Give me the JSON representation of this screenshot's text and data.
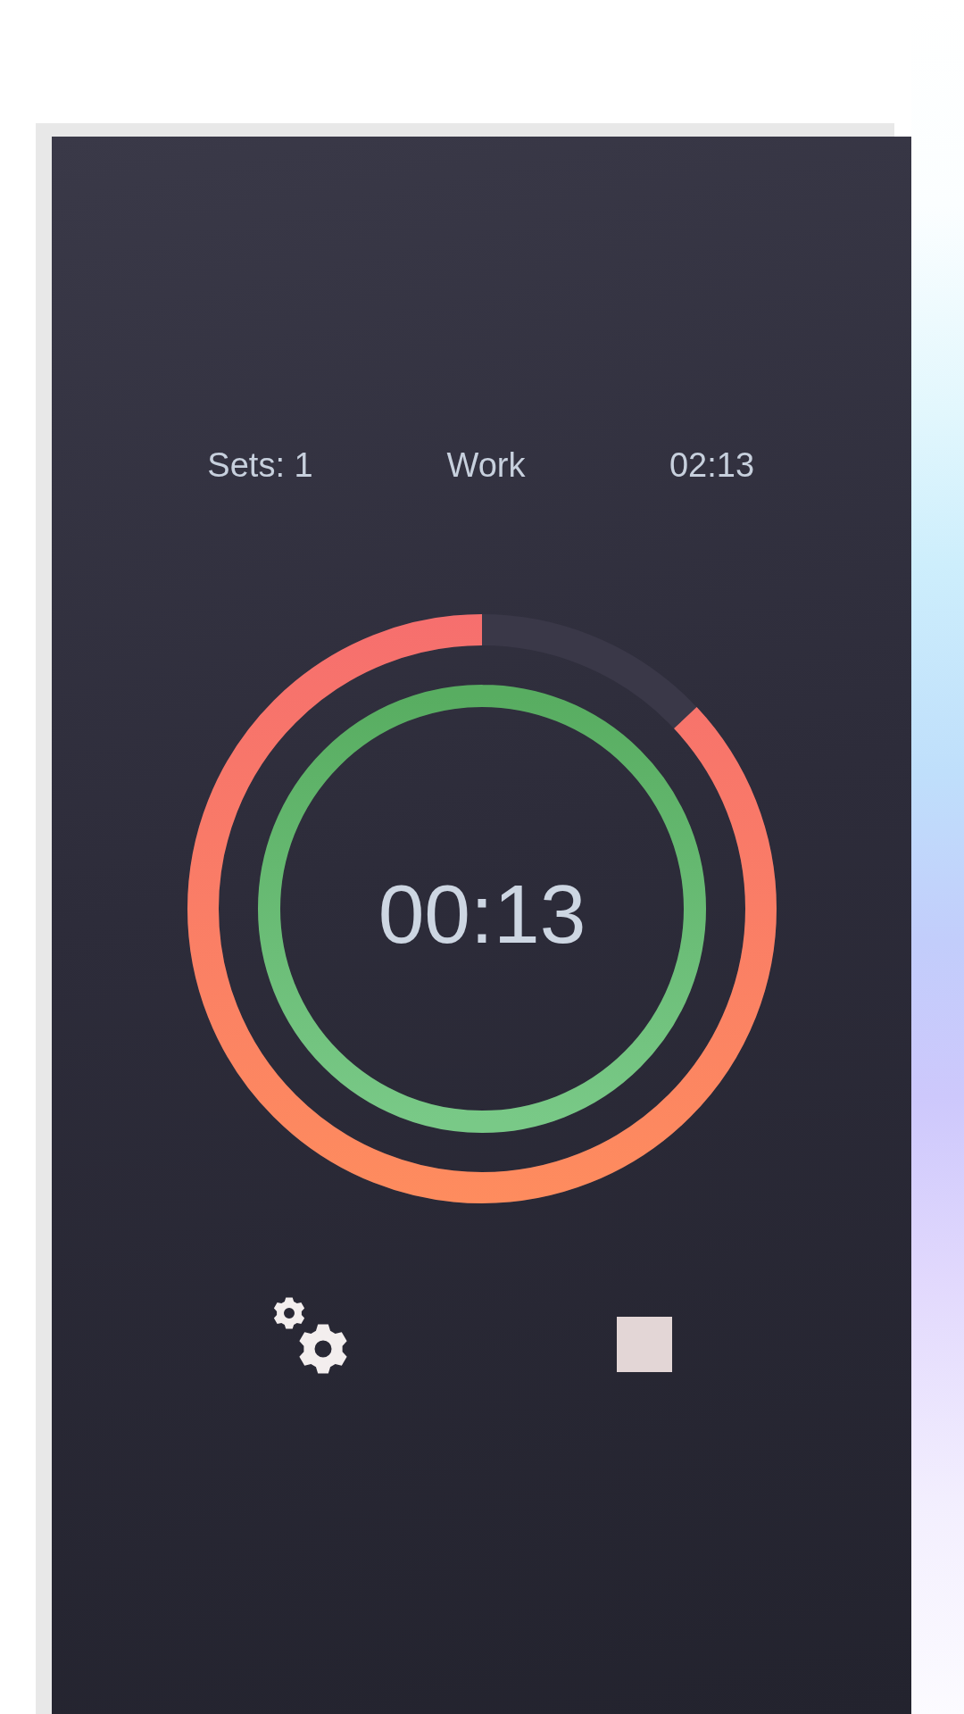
{
  "header": {
    "sets": "Sets: 1",
    "phase": "Work",
    "total_time": "02:13"
  },
  "timer": {
    "time": "00:13",
    "outer_ring": {
      "level": 0.87
    },
    "inner_ring": {
      "level": 1
    }
  },
  "controls": [
    {
      "kind": "settings"
    },
    {
      "kind": "stop"
    }
  ]
}
